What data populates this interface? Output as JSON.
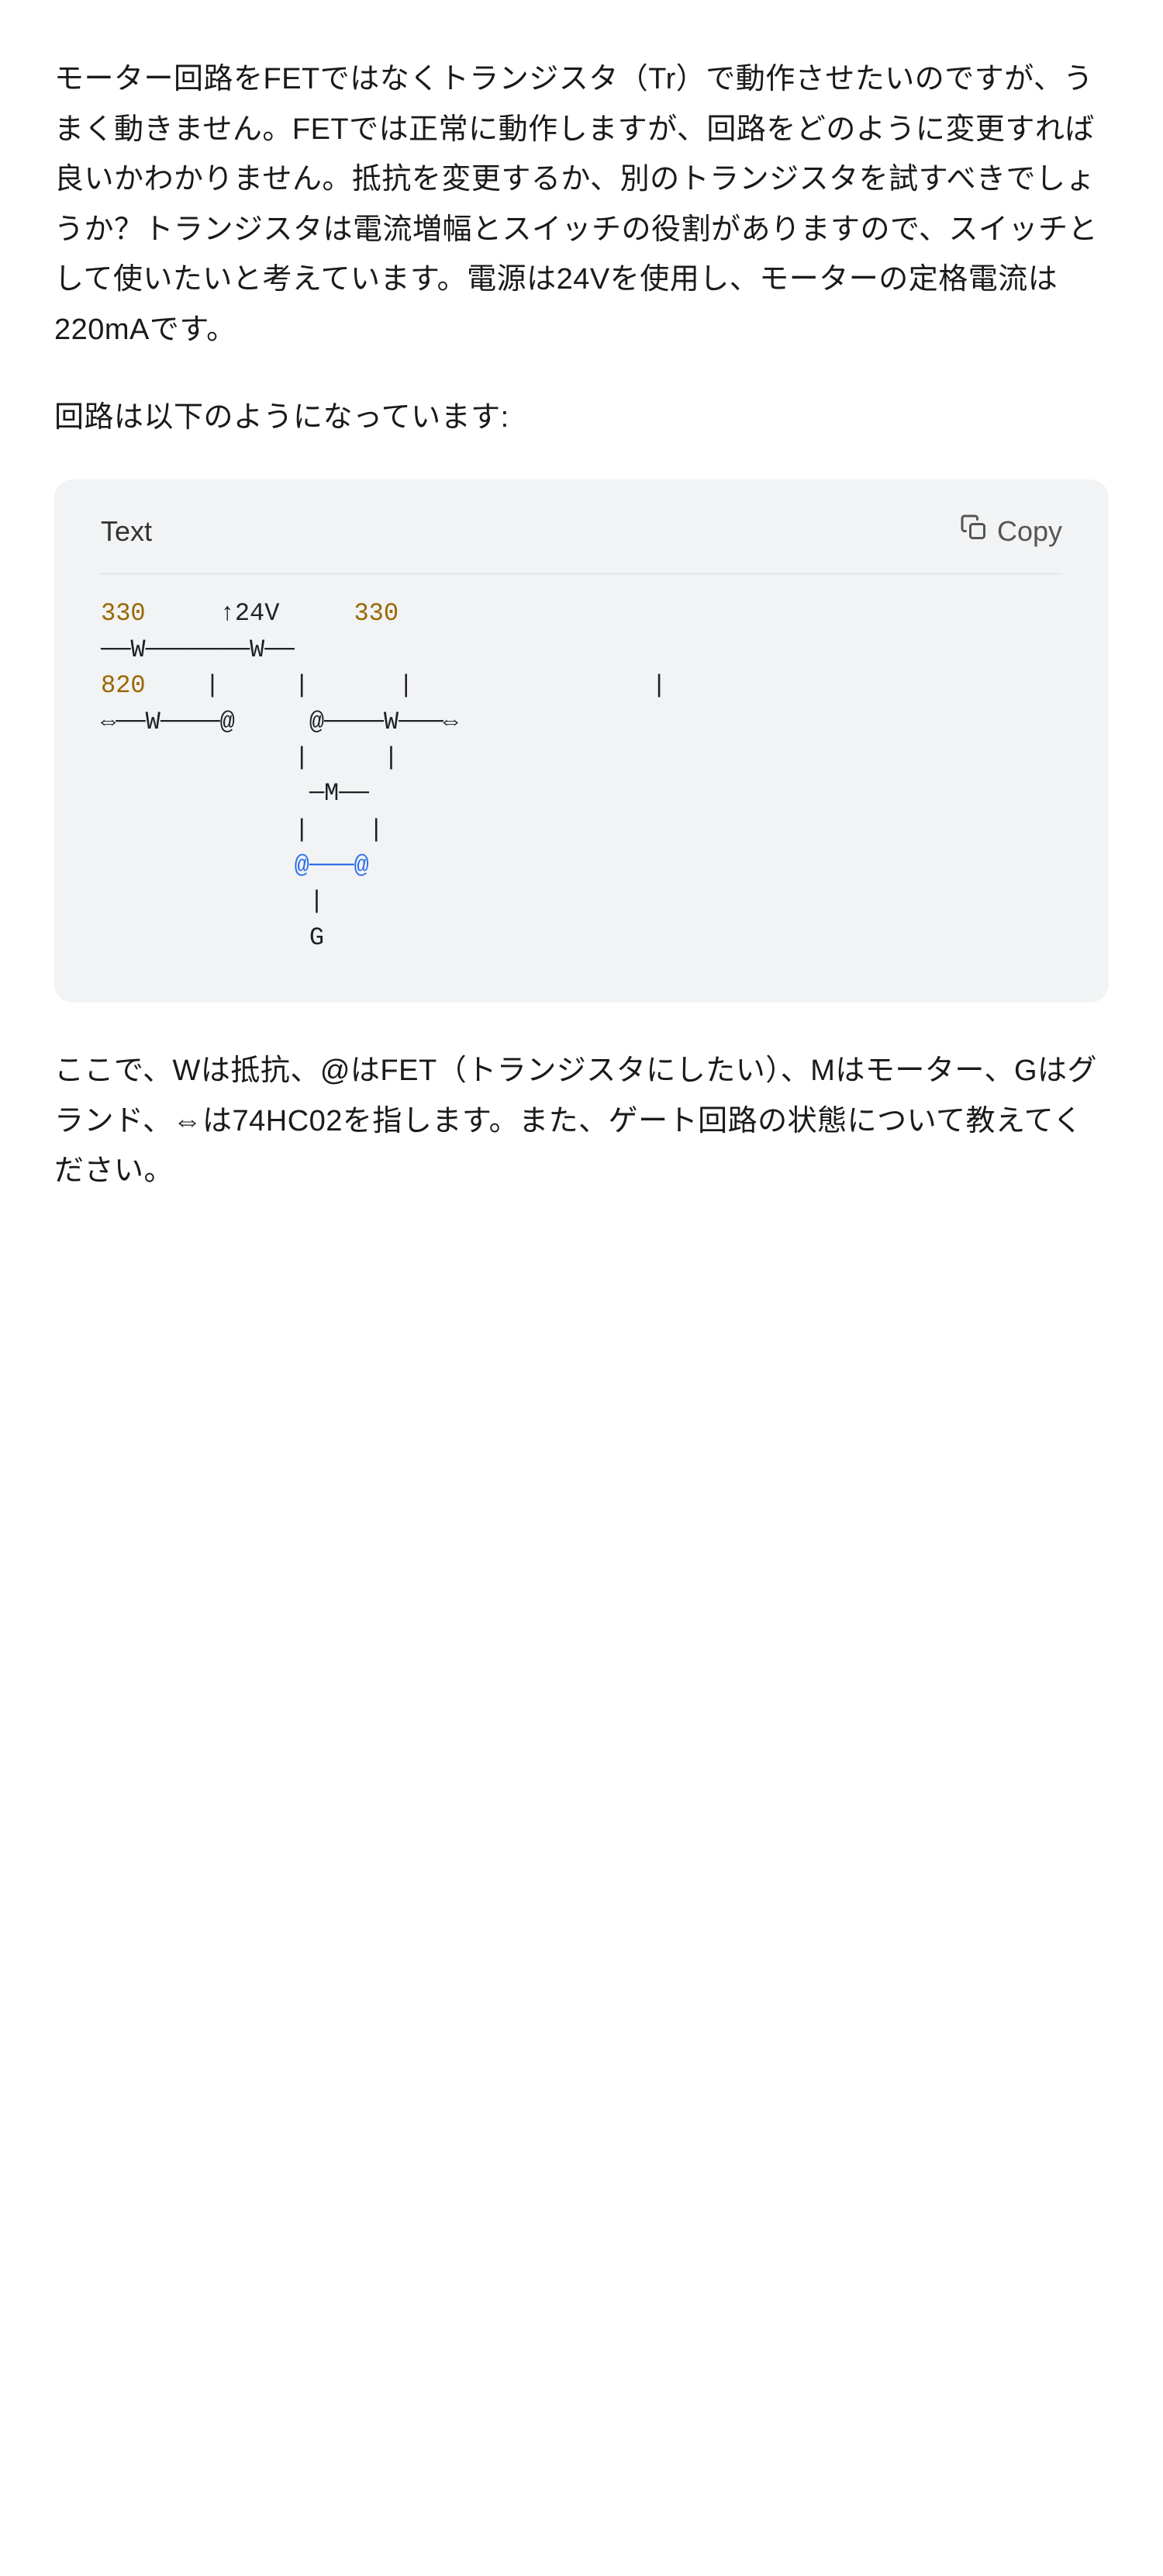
{
  "paragraphs": {
    "p1": "モーター回路をFETではなくトランジスタ（Tr）で動作させたいのですが、うまく動きません。FETでは正常に動作しますが、回路をどのように変更すれば良いかわかりません。抵抗を変更するか、別のトランジスタを試すべきでしょうか？トランジスタは電流増幅とスイッチの役割がありますので、スイッチとして使いたいと考えています。電源は24Vを使用し、モーターの定格電流は220mAです。",
    "p2": "回路は以下のようになっています:",
    "p3": "ここで、Wは抵抗、@はFET（トランジスタにしたい）、Mはモーター、Gはグランド、⇔は74HC02を指します。また、ゲート回路の状態について教えてください。"
  },
  "code": {
    "lang_label": "Text",
    "copy_label": "Copy",
    "lines": {
      "l1_a": "330",
      "l1_b": "     ↑24V     ",
      "l1_c": "330",
      "l2": "──W───────W──",
      "l3_a": "820",
      "l3_b": "    |     |      |                |",
      "l4": "⇔──W────@     @────W───⇔",
      "l5": "             |     |",
      "l6": "              ─M──",
      "l7": "             |    |",
      "l8": "             @───@",
      "l9": "              |",
      "l10": "              G"
    }
  }
}
